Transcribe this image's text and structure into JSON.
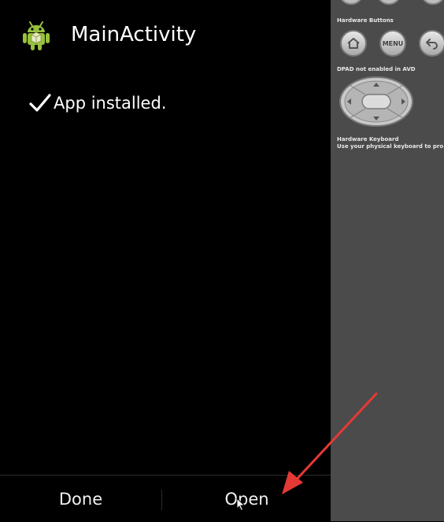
{
  "app": {
    "title": "MainActivity",
    "status": "App installed.",
    "icon": "android-robot-icon"
  },
  "buttons": {
    "done": "Done",
    "open": "Open"
  },
  "emulator_panel": {
    "hardware_buttons_label": "Hardware Buttons",
    "menu_label": "MENU",
    "dpad_label": "DPAD not enabled in AVD",
    "keyboard_label": "Hardware Keyboard",
    "keyboard_hint": "Use your physical keyboard to pro"
  },
  "colors": {
    "screen_bg": "#000000",
    "panel_bg": "#4b4b4b",
    "android_green": "#97c03d",
    "annotation_arrow": "#e53935"
  }
}
